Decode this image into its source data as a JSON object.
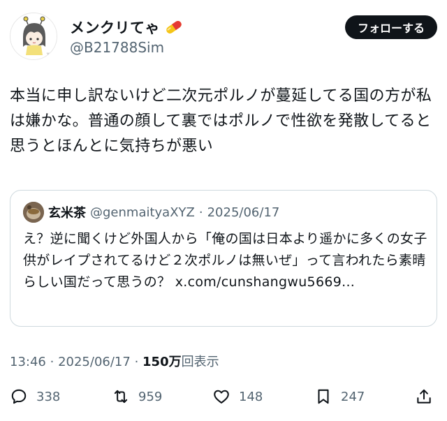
{
  "author": {
    "display_name": "メンクリてゃ",
    "handle": "@B21788Sim",
    "avatar_icon": "bear-girl-avatar-icon",
    "name_emoji_icon": "pill-icon"
  },
  "follow_button": {
    "label": "フォローする"
  },
  "tweet": {
    "text": "本当に申し訳ないけど二次元ポルノが蔓延してる国の方が私は嫌かな。普通の顔して裏ではポルノで性欲を発散してると思うとほんとに気持ちが悪い"
  },
  "quote": {
    "name": "玄米茶",
    "handle": "@genmaityaXYZ",
    "separator": "·",
    "date": "2025/06/17",
    "text": "え？逆に聞くけど外国人から「俺の国は日本より遥かに多くの女子供がレイプされてるけど２次ポルノは無いぜ」って言われたら素晴らしい国だって思うの？ x.com/cunshangwu5669..."
  },
  "meta": {
    "time": "13:46",
    "separator": "·",
    "date": "2025/06/17",
    "views_count": "150万",
    "views_label": "回表示"
  },
  "actions": {
    "replies": "338",
    "reposts": "959",
    "likes": "148",
    "bookmarks": "247"
  },
  "colors": {
    "text": "#0f1419",
    "secondary": "#536471",
    "border": "#cfd9de",
    "follow_bg": "#0f1419"
  }
}
